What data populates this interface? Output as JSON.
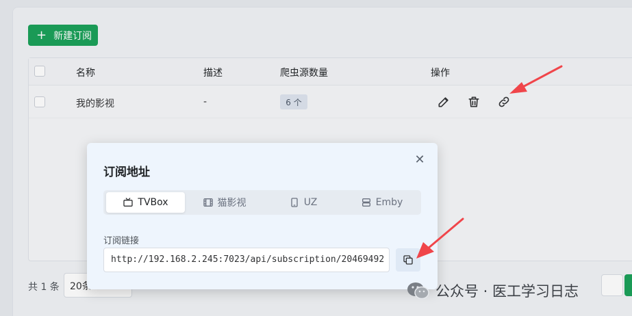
{
  "toolbar": {
    "new_label": "新建订阅"
  },
  "table": {
    "headers": [
      "名称",
      "描述",
      "爬虫源数量",
      "操作"
    ],
    "rows": [
      {
        "name": "我的影视",
        "description": "-",
        "count": "6 个"
      }
    ]
  },
  "pagination": {
    "total": "共 1 条",
    "page_size": "20条"
  },
  "modal": {
    "title": "订阅地址",
    "tabs": [
      {
        "label": "TVBox",
        "icon": "tv-icon"
      },
      {
        "label": "猫影视",
        "icon": "film-icon"
      },
      {
        "label": "UZ",
        "icon": "phone-icon"
      },
      {
        "label": "Emby",
        "icon": "server-icon"
      }
    ],
    "active_tab": "TVBox",
    "url_label": "订阅链接",
    "url_value": "http://192.168.2.245:7023/api/subscription/20469492"
  },
  "watermark": {
    "text": "公众号 · 医工学习日志"
  },
  "colors": {
    "primary": "#18a058",
    "arrow": "#f0454a"
  }
}
